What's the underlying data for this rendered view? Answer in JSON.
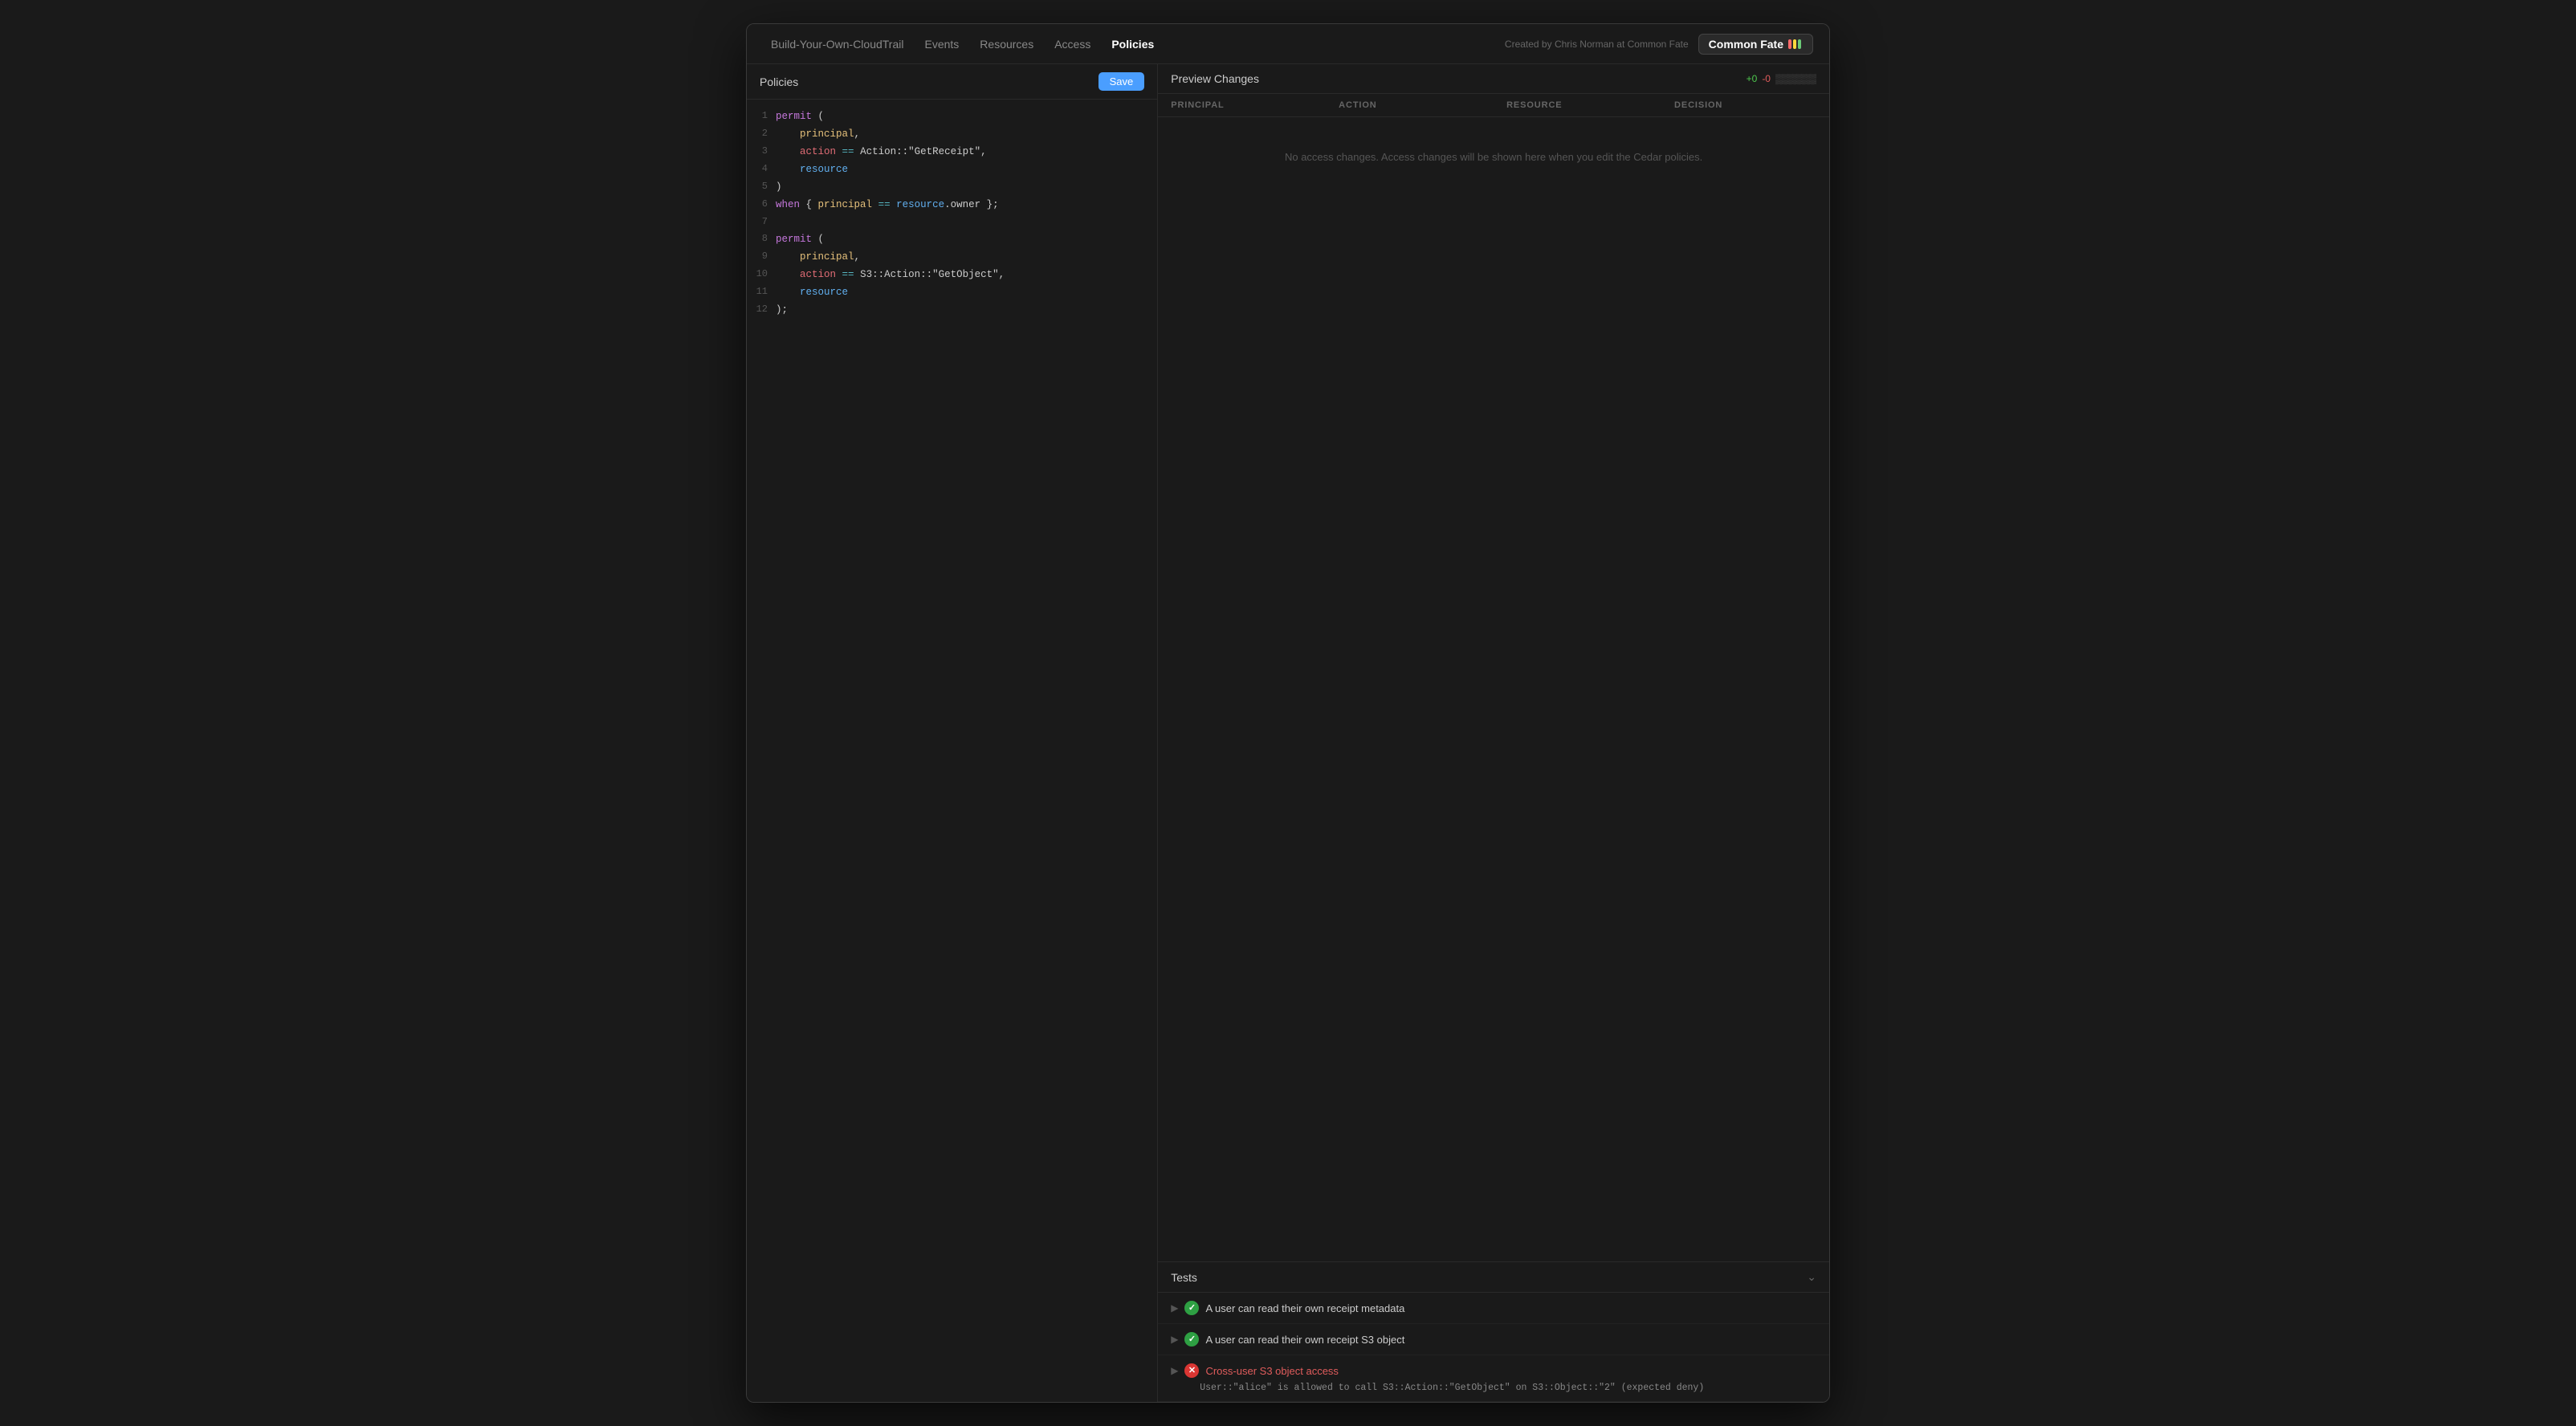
{
  "nav": {
    "links": [
      {
        "label": "Build-Your-Own-CloudTrail",
        "active": false
      },
      {
        "label": "Events",
        "active": false
      },
      {
        "label": "Resources",
        "active": false
      },
      {
        "label": "Access",
        "active": false
      },
      {
        "label": "Policies",
        "active": true
      }
    ],
    "created_by": "Created by Chris Norman at Common Fate",
    "brand": {
      "text": "Common Fate",
      "stripes": [
        "#ff6b6b",
        "#ffd93d",
        "#6bcb77"
      ]
    }
  },
  "left_panel": {
    "title": "Policies",
    "save_button": "Save",
    "code_lines": [
      {
        "num": 1,
        "raw": "permit ("
      },
      {
        "num": 2,
        "raw": "    principal,"
      },
      {
        "num": 3,
        "raw": "    action == Action::\"GetReceipt\","
      },
      {
        "num": 4,
        "raw": "    resource"
      },
      {
        "num": 5,
        "raw": ")"
      },
      {
        "num": 6,
        "raw": "when { principal == resource.owner };"
      },
      {
        "num": 7,
        "raw": ""
      },
      {
        "num": 8,
        "raw": "permit ("
      },
      {
        "num": 9,
        "raw": "    principal,"
      },
      {
        "num": 10,
        "raw": "    action == S3::Action::\"GetObject\","
      },
      {
        "num": 11,
        "raw": "    resource"
      },
      {
        "num": 12,
        "raw": ");"
      }
    ]
  },
  "right_panel": {
    "title": "Preview Changes",
    "diff_add": "+0",
    "diff_remove": "-0",
    "diff_dots": "▒▒▒▒▒▒",
    "table_headers": [
      "PRINCIPAL",
      "ACTION",
      "RESOURCE",
      "DECISION"
    ],
    "empty_state": "No access changes. Access changes will be shown here when you edit the Cedar policies."
  },
  "tests": {
    "title": "Tests",
    "items": [
      {
        "status": "pass",
        "label": "A user can read their own receipt metadata",
        "detail": null
      },
      {
        "status": "pass",
        "label": "A user can read their own receipt S3 object",
        "detail": null
      },
      {
        "status": "fail",
        "label": "Cross-user S3 object access",
        "detail": "User::\"alice\" is allowed to call S3::Action::\"GetObject\" on S3::Object::\"2\" (expected deny)"
      }
    ]
  }
}
